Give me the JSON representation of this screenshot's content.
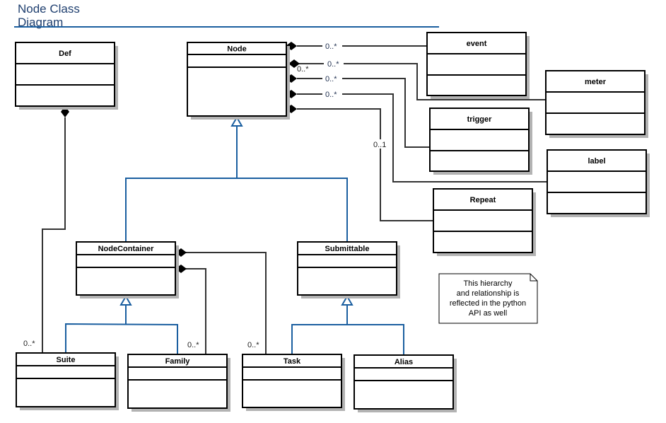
{
  "title": "Node Class Diagram",
  "title_lines": [
    "Node Class",
    "Diagram"
  ],
  "colors": {
    "inheritance": "#1b5fa0",
    "association": "#333333",
    "title": "#1f3f6f",
    "shadow": "#b3b3b3"
  },
  "classes": {
    "def": {
      "name": "Def"
    },
    "node": {
      "name": "Node"
    },
    "event": {
      "name": "event"
    },
    "meter": {
      "name": "meter"
    },
    "trigger": {
      "name": "trigger"
    },
    "label": {
      "name": "label"
    },
    "repeat": {
      "name": "Repeat"
    },
    "nodecontainer": {
      "name": "NodeContainer"
    },
    "submittable": {
      "name": "Submittable"
    },
    "suite": {
      "name": "Suite"
    },
    "family": {
      "name": "Family"
    },
    "task": {
      "name": "Task"
    },
    "alias": {
      "name": "Alias"
    }
  },
  "multiplicities": {
    "node_event": "0..*",
    "node_meter": "0..*",
    "node_meter_extra": "0..*",
    "node_trigger": "0..*",
    "node_label": "0..*",
    "node_repeat": "0..1",
    "def_suite": "0..*",
    "container_family": "0..*",
    "container_task": "0..*"
  },
  "note": {
    "lines": [
      "This hierarchy",
      "and relationship is",
      "reflected in the python",
      "API as well"
    ]
  }
}
